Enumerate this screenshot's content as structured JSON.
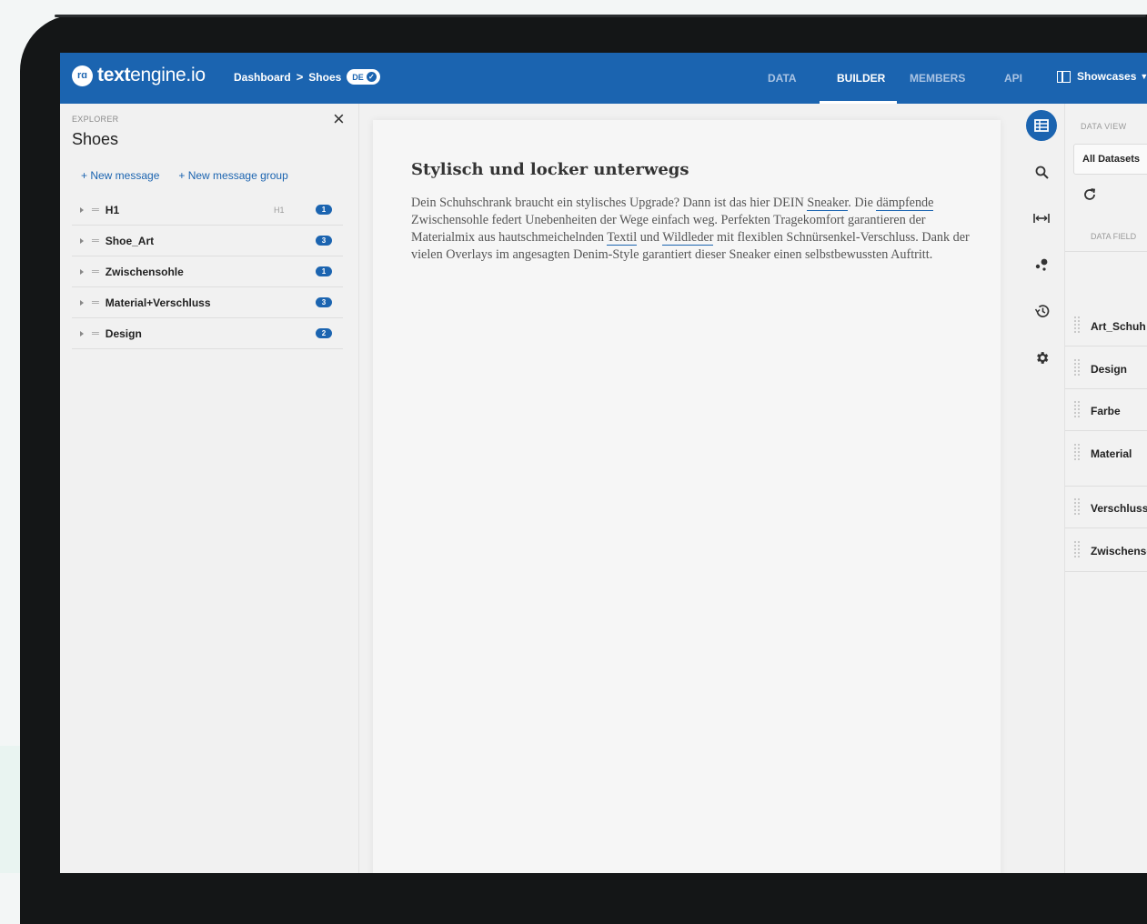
{
  "app": {
    "logo_text_bold": "text",
    "logo_text_regular": "engine.io",
    "logo_icon": "text-engine-logo-icon"
  },
  "breadcrumb": {
    "items": [
      "Dashboard",
      "Shoes"
    ],
    "language_badge": "DE",
    "language_status_icon": "check-circle-icon"
  },
  "nav": {
    "tabs": [
      {
        "label": "DATA"
      },
      {
        "label": "BUILDER",
        "active": true
      },
      {
        "label": "MEMBERS"
      },
      {
        "label": "API"
      }
    ],
    "showcases_label": "Showcases"
  },
  "explorer": {
    "section_label": "EXPLORER",
    "title": "Shoes",
    "new_message": "+ New message",
    "new_message_group": "+ New message group",
    "items": [
      {
        "label": "H1",
        "tag": "H1",
        "count": "1"
      },
      {
        "label": "Shoe_Art",
        "tag": "",
        "count": "3"
      },
      {
        "label": "Zwischensohle",
        "tag": "",
        "count": "1"
      },
      {
        "label": "Material+Verschluss",
        "tag": "",
        "count": "3"
      },
      {
        "label": "Design",
        "tag": "",
        "count": "2"
      }
    ]
  },
  "document": {
    "title": "Stylisch und locker unterwegs",
    "p1": "Dein Schuhschrank braucht ein stylisches Upgrade? Dann ist das hier DEIN ",
    "link1": "Sneaker",
    "p2": ". Die ",
    "link2": "dämpfende",
    "p3": " Zwischensohle federt Unebenheiten der Wege einfach weg. Perfekten Tragekomfort garantieren der Materialmix aus hautschmeichelnden ",
    "link3": "Textil",
    "p4": " und ",
    "link4": "Wildleder",
    "p5": " mit flexiblen Schnürsenkel-Verschluss. Dank der vielen Overlays im angesagten Denim-Style garantiert dieser Sneaker einen selbstbewussten Auftritt."
  },
  "rail": {
    "icons": [
      "table-icon",
      "search-icon",
      "width-icon",
      "branch-icon",
      "history-icon",
      "gear-icon"
    ]
  },
  "data_view": {
    "section_label": "DATA VIEW",
    "dataset_select": "All Datasets",
    "field_label": "DATA FIELD",
    "fields": [
      "Art_Schuh",
      "Design",
      "Farbe",
      "Material",
      "Verschluss",
      "Zwischenso"
    ]
  },
  "colors": {
    "primary": "#1b64b0",
    "device_frame": "#141617"
  }
}
